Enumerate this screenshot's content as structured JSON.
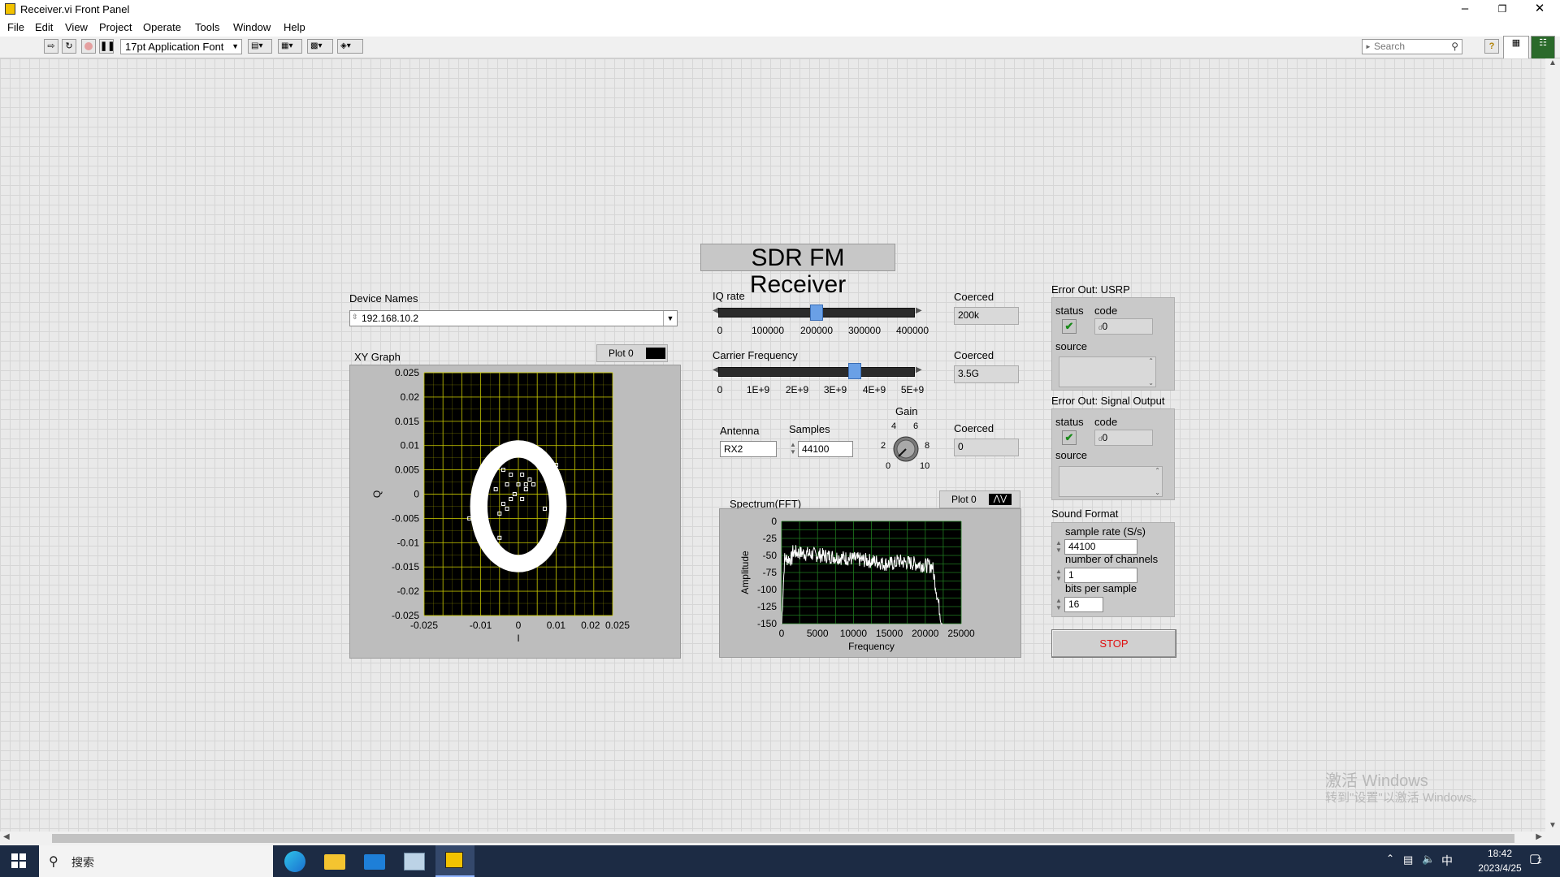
{
  "window": {
    "title": "Receiver.vi Front Panel"
  },
  "menu": [
    "File",
    "Edit",
    "View",
    "Project",
    "Operate",
    "Tools",
    "Window",
    "Help"
  ],
  "toolbar": {
    "font": "17pt Application Font",
    "search_placeholder": "Search"
  },
  "panel_title": "SDR FM Receiver",
  "device": {
    "label": "Device Names",
    "value": "192.168.10.2"
  },
  "xy_graph": {
    "label": "XY Graph",
    "plot_legend": "Plot 0",
    "xlabel": "I",
    "ylabel": "Q",
    "xticks": [
      "-0.025",
      "-0.01",
      "0",
      "0.01",
      "0.02",
      "0.025"
    ],
    "yticks": [
      "0.025",
      "0.02",
      "0.015",
      "0.01",
      "0.005",
      "0",
      "-0.005",
      "-0.01",
      "-0.015",
      "-0.02",
      "-0.025"
    ]
  },
  "iq_rate": {
    "label": "IQ rate",
    "ticks": [
      "0",
      "100000",
      "200000",
      "300000",
      "400000"
    ],
    "value": 200000,
    "coerced_label": "Coerced",
    "coerced": "200k"
  },
  "carrier": {
    "label": "Carrier Frequency",
    "ticks": [
      "0",
      "1E+9",
      "2E+9",
      "3E+9",
      "4E+9",
      "5E+9"
    ],
    "value": 3500000000,
    "coerced_label": "Coerced",
    "coerced": "3.5G"
  },
  "antenna": {
    "label": "Antenna",
    "value": "RX2"
  },
  "samples": {
    "label": "Samples",
    "value": "44100"
  },
  "gain": {
    "label": "Gain",
    "ticks": [
      "0",
      "2",
      "4",
      "6",
      "8",
      "10"
    ],
    "value": 0,
    "coerced_label": "Coerced",
    "coerced": "0"
  },
  "spectrum": {
    "label": "Spectrum(FFT)",
    "plot_legend": "Plot 0",
    "xlabel": "Frequency",
    "ylabel": "Amplitude",
    "xticks": [
      "0",
      "5000",
      "10000",
      "15000",
      "20000",
      "25000"
    ],
    "yticks": [
      "0",
      "-25",
      "-50",
      "-75",
      "-100",
      "-125",
      "-150"
    ]
  },
  "err_usrp": {
    "label": "Error Out: USRP",
    "status_label": "status",
    "code_label": "code",
    "code": "0",
    "source_label": "source"
  },
  "err_sig": {
    "label": "Error Out: Signal Output",
    "status_label": "status",
    "code_label": "code",
    "code": "0",
    "source_label": "source"
  },
  "sound": {
    "label": "Sound Format",
    "rate_label": "sample rate (S/s)",
    "rate": "44100",
    "ch_label": "number of channels",
    "ch": "1",
    "bits_label": "bits per sample",
    "bits": "16"
  },
  "stop": "STOP",
  "watermark": {
    "line1": "激活 Windows",
    "line2": "转到\"设置\"以激活 Windows。"
  },
  "taskbar": {
    "search": "搜索",
    "time": "18:42",
    "date": "2023/4/25",
    "ime": "中",
    "notif": "2"
  },
  "colors": {
    "plot_bg": "#000000",
    "xy_grid": "#c8c800",
    "spec_grid": "#1f7a1f",
    "data": "#ffffff",
    "stop_text": "#e01010"
  }
}
